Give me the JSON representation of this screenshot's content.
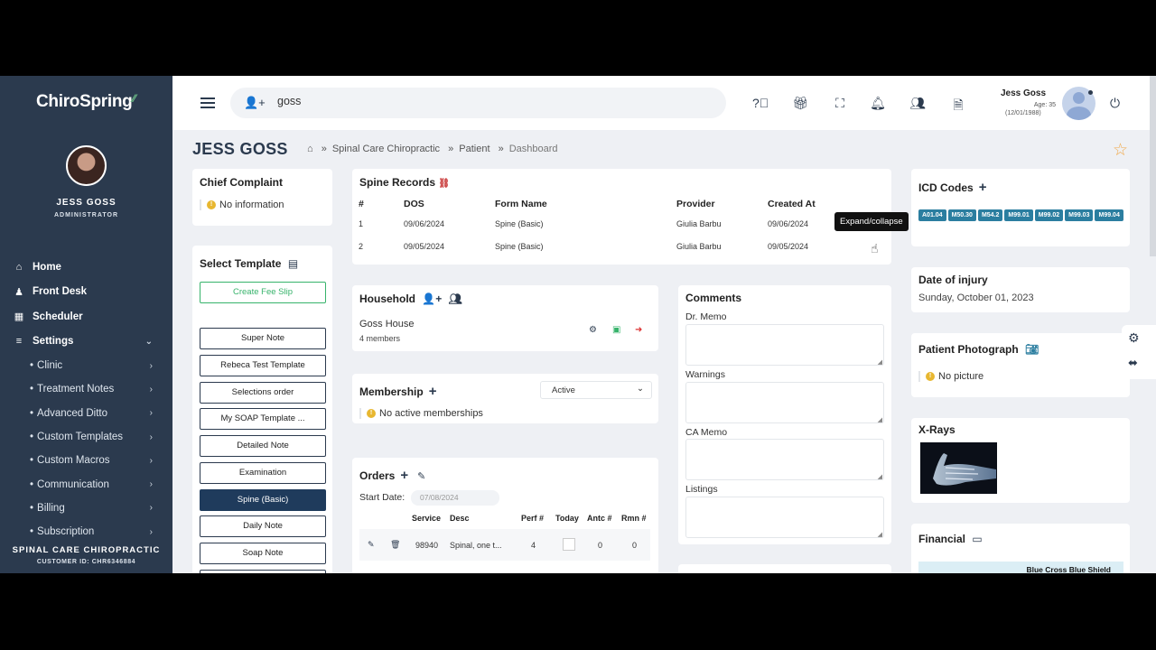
{
  "app": {
    "logo": "ChiroSpring"
  },
  "user": {
    "name": "JESS GOSS",
    "role": "ADMINISTRATOR"
  },
  "nav": {
    "items": [
      {
        "label": "Home",
        "icon": "home-icon",
        "glyph": "⌂"
      },
      {
        "label": "Front Desk",
        "icon": "user-icon",
        "glyph": "♟"
      },
      {
        "label": "Scheduler",
        "icon": "calendar-icon",
        "glyph": "▦"
      },
      {
        "label": "Settings",
        "icon": "sliders-icon",
        "glyph": "≡"
      }
    ],
    "settings_sub": [
      "Clinic",
      "Treatment Notes",
      "Advanced Ditto",
      "Custom Templates",
      "Custom Macros",
      "Communication",
      "Billing",
      "Subscription"
    ]
  },
  "footer": {
    "clinic": "SPINAL CARE CHIROPRACTIC",
    "customer_id": "CUSTOMER ID: CHR6346884"
  },
  "topbar": {
    "search_value": "goss",
    "patient_name": "Jess Goss",
    "patient_age": "Age: 35",
    "patient_dob": "(12/01/1988)"
  },
  "page": {
    "title": "JESS GOSS",
    "breadcrumb": [
      "Spinal Care Chiropractic",
      "Patient",
      "Dashboard"
    ]
  },
  "chief_complaint": {
    "title": "Chief Complaint",
    "text": "No information"
  },
  "select_template": {
    "title": "Select Template",
    "fee_slip": "Create Fee Slip",
    "templates": [
      "Super Note",
      "Rebeca Test Template",
      "Selections order",
      "My SOAP Template ...",
      "Detailed Note",
      "Examination",
      "Spine (Basic)",
      "Daily Note",
      "Soap Note"
    ],
    "active_index": 6
  },
  "spine_records": {
    "title": "Spine Records",
    "columns": [
      "#",
      "DOS",
      "Form Name",
      "Provider",
      "Created At"
    ],
    "rows": [
      [
        "1",
        "09/06/2024",
        "Spine (Basic)",
        "Giulia Barbu",
        "09/06/2024"
      ],
      [
        "2",
        "09/05/2024",
        "Spine (Basic)",
        "Giulia Barbu",
        "09/05/2024"
      ]
    ],
    "tooltip": "Expand/collapse"
  },
  "household": {
    "title": "Household",
    "name": "Goss House",
    "members": "4 members"
  },
  "membership": {
    "title": "Membership",
    "status_select": "Active",
    "text": "No active memberships"
  },
  "orders": {
    "title": "Orders",
    "start_date_label": "Start Date:",
    "start_date_value": "07/08/2024",
    "columns": [
      "Service",
      "Desc",
      "Perf #",
      "Today",
      "Antc #",
      "Rmn #"
    ],
    "rows": [
      [
        "98940",
        "Spinal, one t...",
        "4",
        "",
        "0",
        "0"
      ]
    ]
  },
  "comments": {
    "title": "Comments",
    "fields": [
      "Dr. Memo",
      "Warnings",
      "CA Memo",
      "Listings"
    ]
  },
  "icd": {
    "title": "ICD Codes",
    "codes": [
      "A01.04",
      "M50.30",
      "M54.2",
      "M99.01",
      "M99.02",
      "M99.03",
      "M99.04"
    ],
    "tag_color": "#2b7ea0"
  },
  "date_of_injury": {
    "title": "Date of injury",
    "value": "Sunday, October 01, 2023"
  },
  "patient_photo": {
    "title": "Patient Photograph",
    "text": "No picture"
  },
  "xrays": {
    "title": "X-Rays"
  },
  "financial": {
    "title": "Financial",
    "insurer": "Blue Cross Blue Shield"
  },
  "colors": {
    "sidebar": "#2b3a4e",
    "accent_green": "#37b36b",
    "active_template": "#1f3b5c",
    "star": "#f0a94a"
  }
}
